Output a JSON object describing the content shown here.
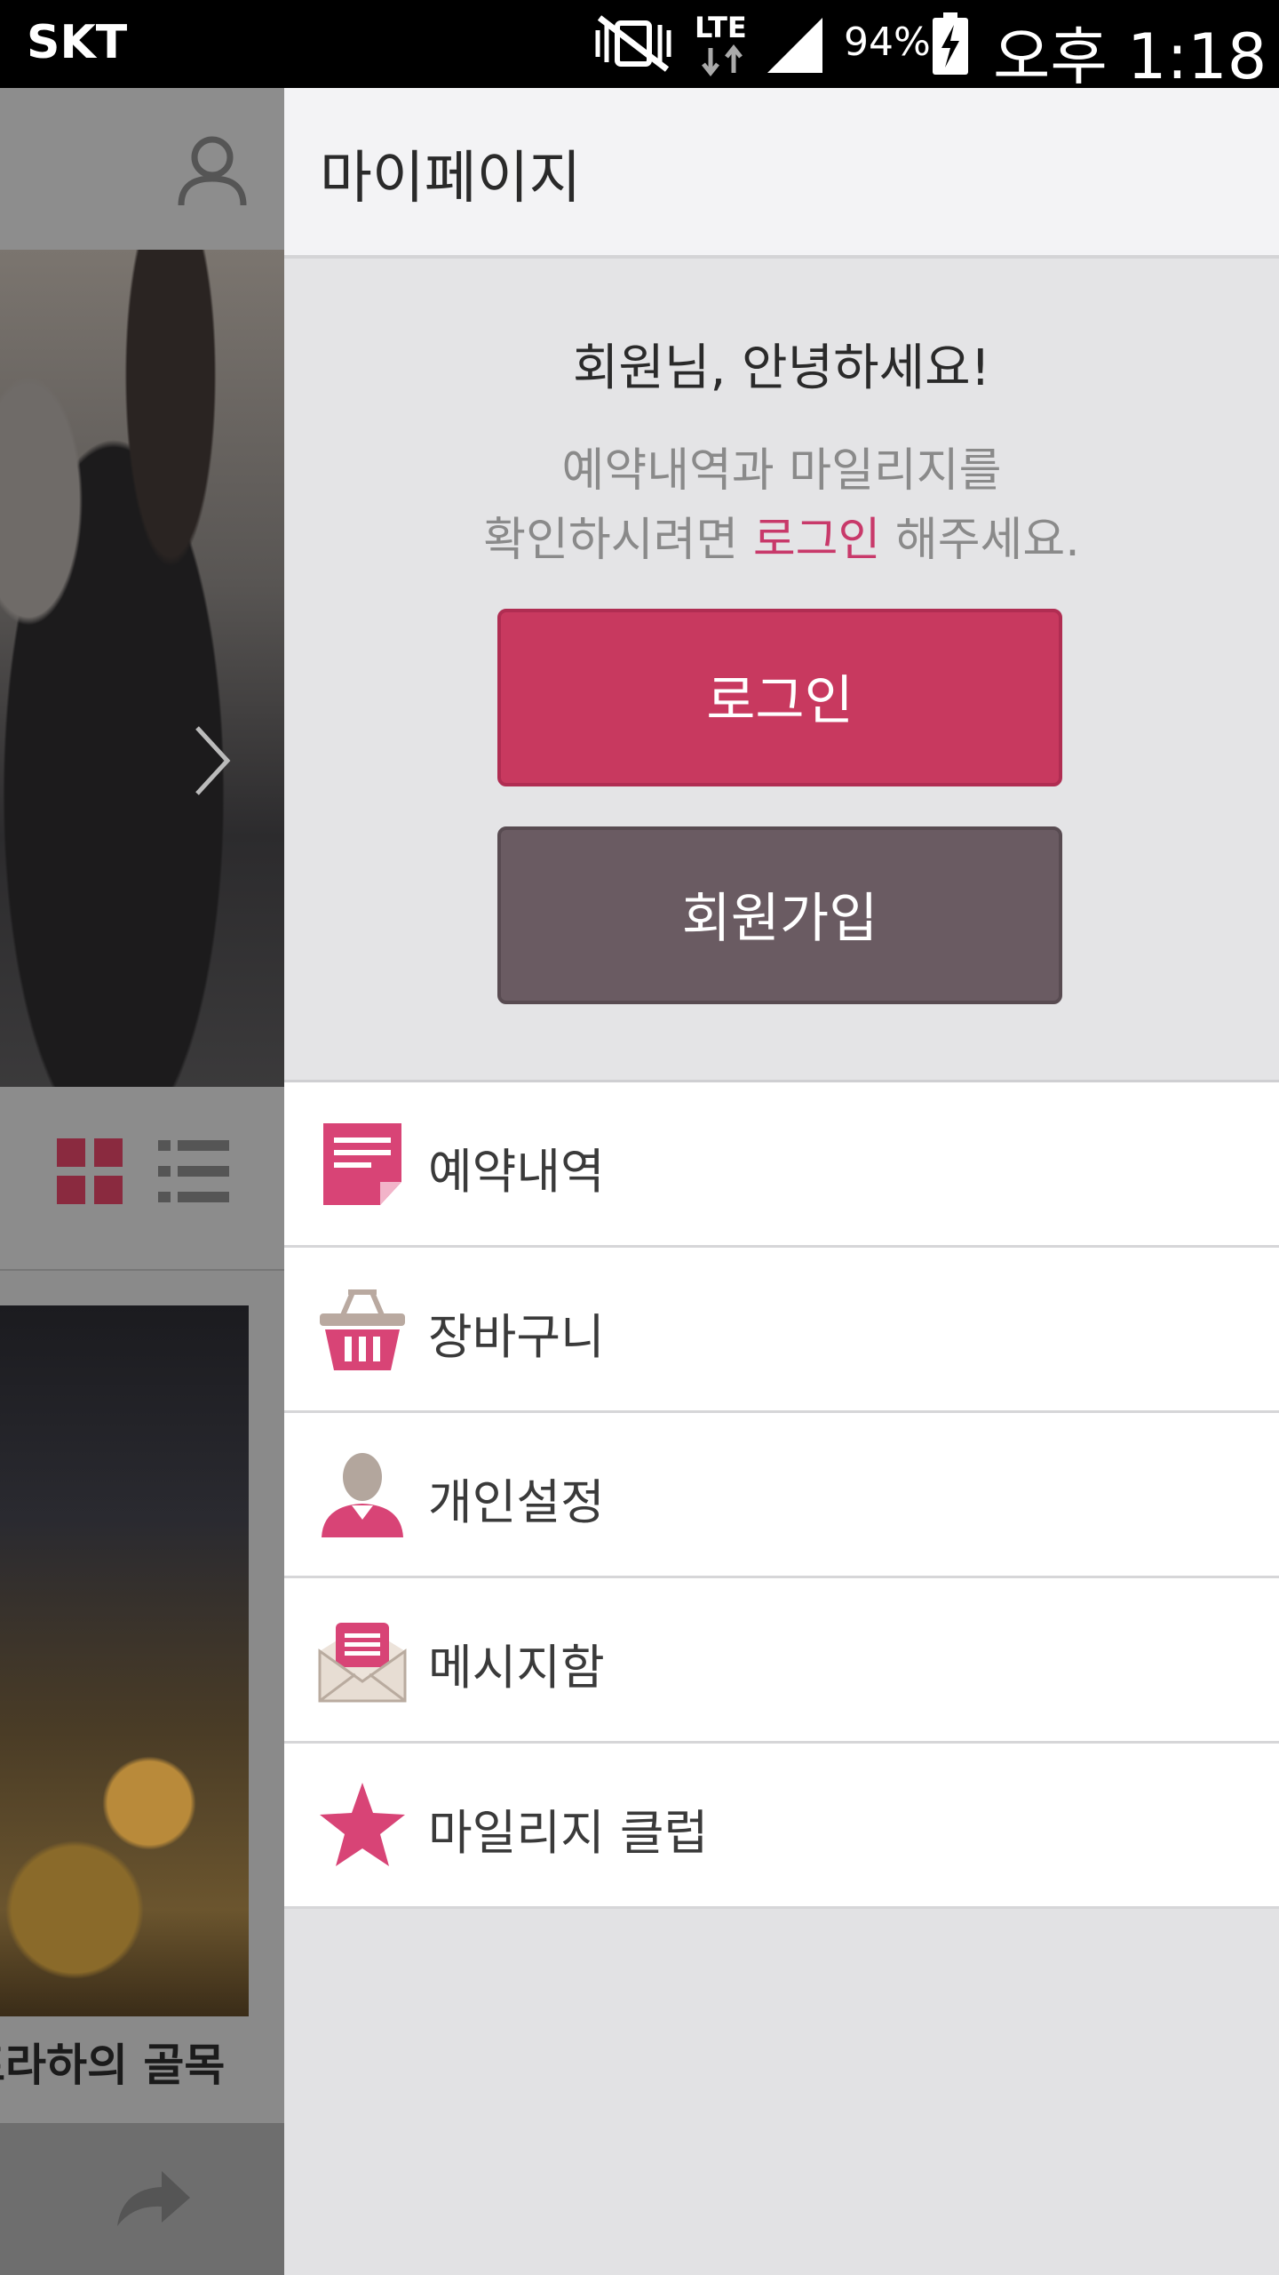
{
  "status_bar": {
    "carrier": "SKT",
    "network": "LTE",
    "battery": "94%",
    "time": "오후 1:18"
  },
  "background": {
    "caption": "프라하의 골목"
  },
  "drawer": {
    "title": "마이페이지",
    "greeting": "회원님, 안녕하세요!",
    "message_line1": "예약내역과 마일리지를",
    "message_line2_pre": "확인하시려면 ",
    "message_line2_link": "로그인",
    "message_line2_post": " 해주세요.",
    "login_label": "로그인",
    "join_label": "회원가입",
    "menu": [
      {
        "label": "예약내역",
        "icon": "reservation-icon"
      },
      {
        "label": "장바구니",
        "icon": "basket-icon"
      },
      {
        "label": "개인설정",
        "icon": "person-icon"
      },
      {
        "label": "메시지함",
        "icon": "message-icon"
      },
      {
        "label": "마일리지 클럽",
        "icon": "star-icon"
      }
    ]
  },
  "colors": {
    "accent": "#c8395f",
    "join_button": "#6a5b62",
    "highlight_text": "#c8396a"
  }
}
